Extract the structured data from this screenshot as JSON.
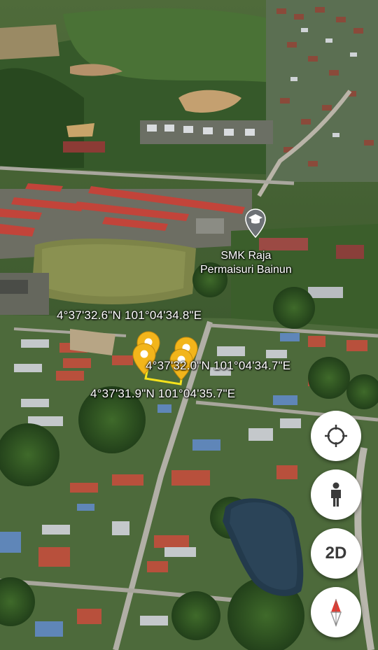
{
  "map": {
    "type": "3d-satellite",
    "accent_color": "#f2b51b",
    "route_color": "#f5e21c"
  },
  "poi": {
    "name_line1": "SMK Raja",
    "name_line2": "Permaisuri Bainun",
    "icon": "graduation-cap-icon"
  },
  "coordinates": [
    {
      "text": "4°37'32.6\"N 101°04'34.8\"E"
    },
    {
      "text": "4°37'32.0\"N 101°04'34.7\"E"
    },
    {
      "text": "4°37'31.9\"N 101°04'35.7\"E"
    }
  ],
  "controls": {
    "locate_icon": "crosshair-icon",
    "streetview_icon": "person-icon",
    "view_mode_label": "2D",
    "compass_icon": "compass-icon"
  }
}
